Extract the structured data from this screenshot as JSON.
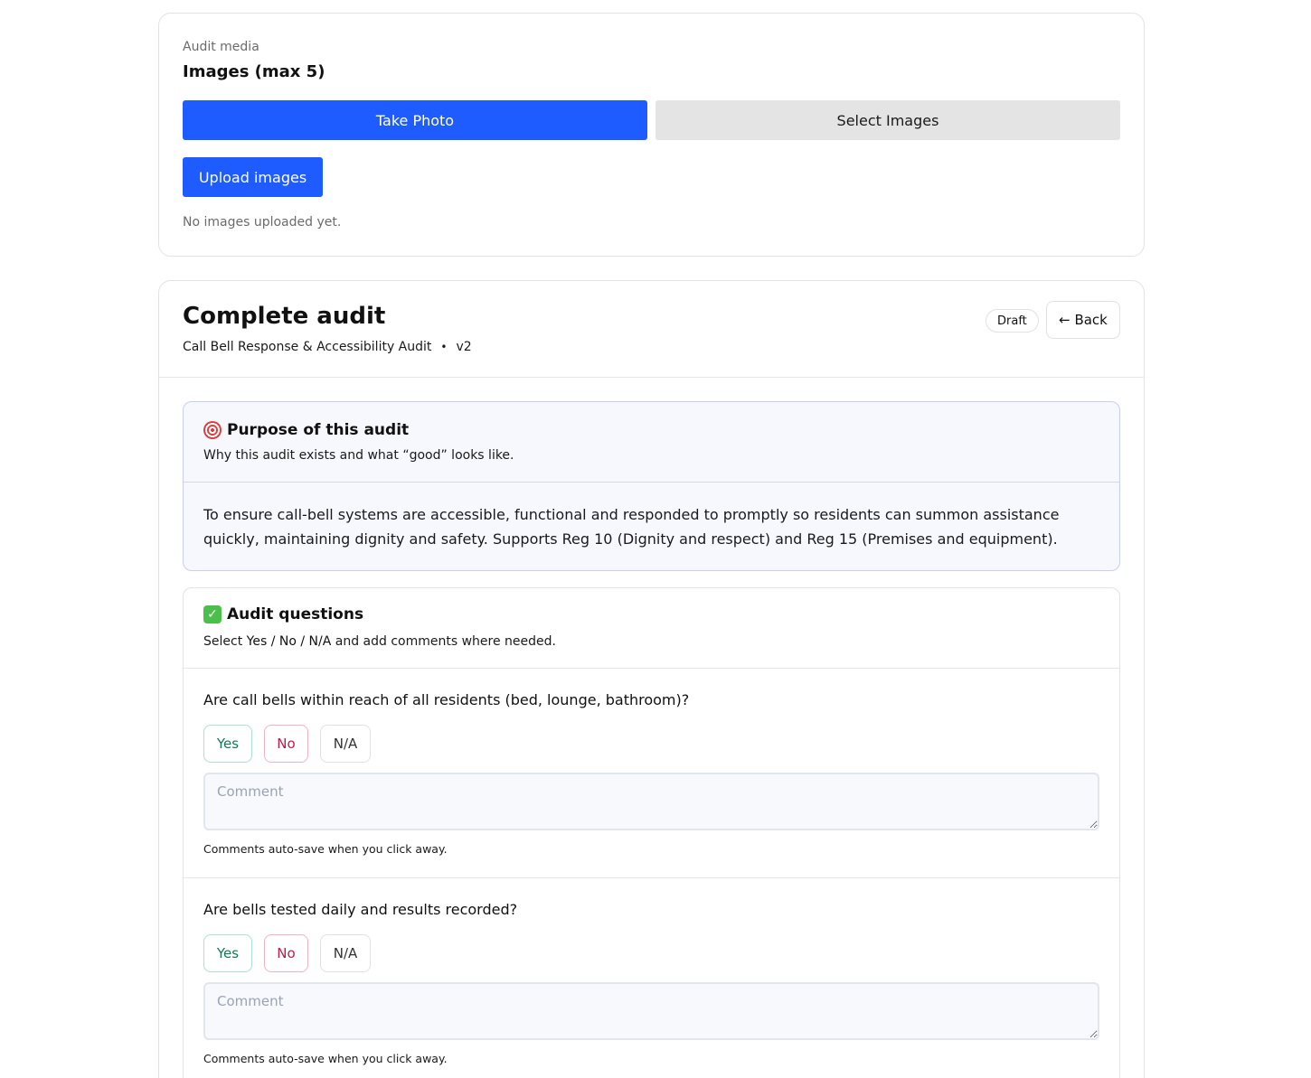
{
  "media": {
    "eyebrow": "Audit media",
    "title": "Images (max 5)",
    "take_photo_label": "Take Photo",
    "select_images_label": "Select Images",
    "upload_label": "Upload images",
    "empty_text": "No images uploaded yet."
  },
  "audit": {
    "title": "Complete audit",
    "name": "Call Bell Response & Accessibility Audit",
    "separator": "•",
    "version": "v2",
    "status_badge": "Draft",
    "back_label": "← Back"
  },
  "purpose": {
    "title": "Purpose of this audit",
    "subtitle": "Why this audit exists and what “good” looks like.",
    "body": "To ensure call-bell systems are accessible, functional and responded to promptly so residents can summon assistance quickly, maintaining dignity and safety. Supports Reg 10 (Dignity and respect) and Reg 15 (Premises and equipment)."
  },
  "questions_section": {
    "title": "Audit questions",
    "subtitle_prefix": "Select",
    "subtitle_options": "Yes / No / N/A",
    "subtitle_suffix": "and add comments where needed."
  },
  "questions": [
    {
      "text": "Are call bells within reach of all residents (bed, lounge, bathroom)?",
      "yes_label": "Yes",
      "no_label": "No",
      "na_label": "N/A",
      "comment_placeholder": "Comment",
      "note": "Comments auto-save when you click away."
    },
    {
      "text": "Are bells tested daily and results recorded?",
      "yes_label": "Yes",
      "no_label": "No",
      "na_label": "N/A",
      "comment_placeholder": "Comment",
      "note": "Comments auto-save when you click away."
    }
  ],
  "colors": {
    "primary": "#1e5cff",
    "yes": "#0f7a55",
    "no": "#c21a47"
  },
  "icons": {
    "purpose": "target-icon",
    "questions": "check-icon"
  }
}
